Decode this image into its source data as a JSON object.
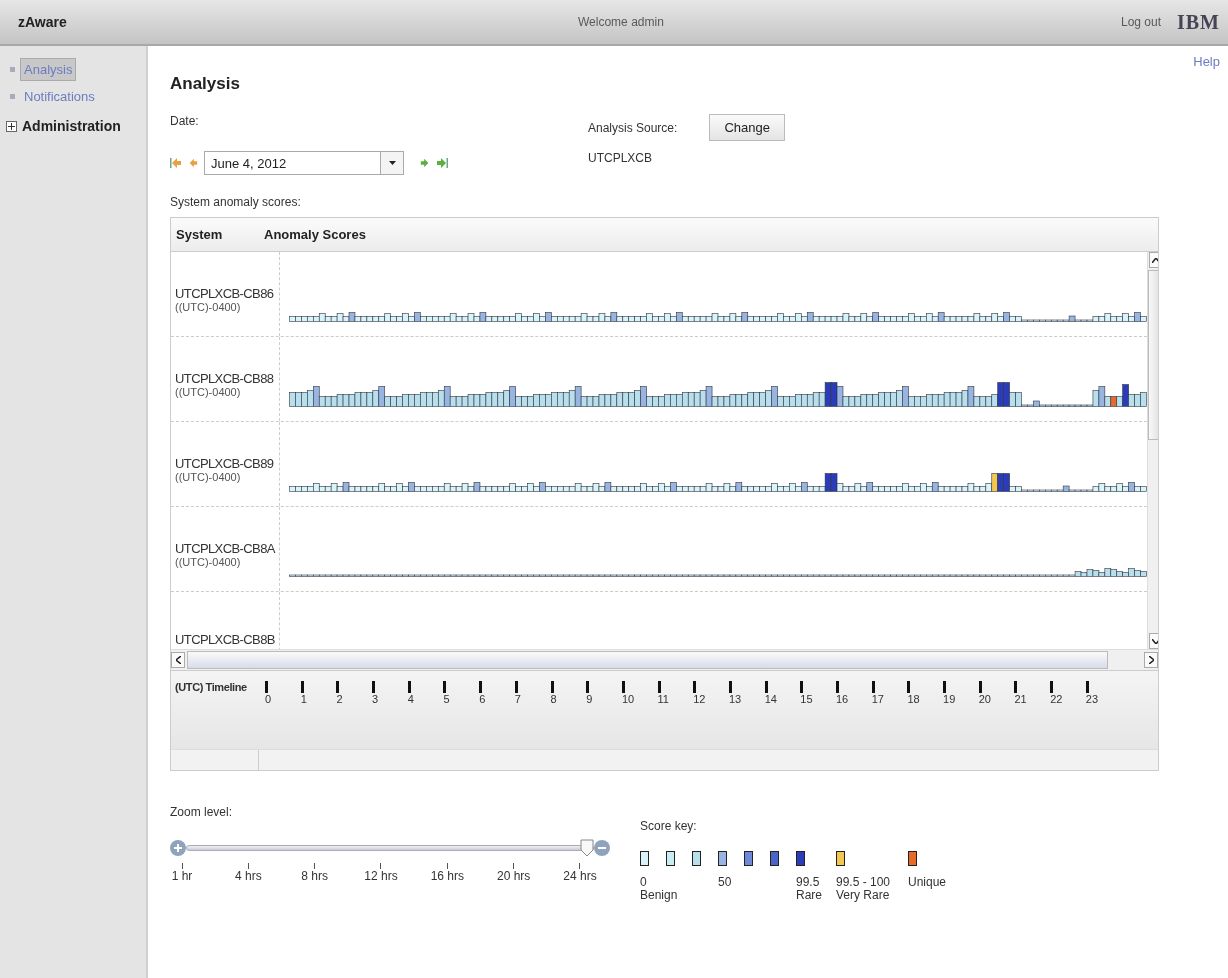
{
  "header": {
    "app_name": "zAware",
    "welcome": "Welcome admin",
    "logout": "Log out",
    "logo": "IBM"
  },
  "sidebar": {
    "items": [
      {
        "kind": "link",
        "label": "Analysis",
        "selected": true
      },
      {
        "kind": "link",
        "label": "Notifications",
        "selected": false
      },
      {
        "kind": "group",
        "label": "Administration",
        "selected": false,
        "expanded": false
      }
    ]
  },
  "help": "Help",
  "page_title": "Analysis",
  "date": {
    "label": "Date:",
    "value": "June 4, 2012"
  },
  "source": {
    "label": "Analysis Source:",
    "button": "Change",
    "value": "UTCPLXCB"
  },
  "table": {
    "caption": "System anomaly scores:",
    "columns": [
      "System",
      "Anomaly Scores"
    ],
    "rows": [
      {
        "system": "UTCPLXCB-CB86",
        "timezone": "((UTC)-0400)"
      },
      {
        "system": "UTCPLXCB-CB88",
        "timezone": "((UTC)-0400)"
      },
      {
        "system": "UTCPLXCB-CB89",
        "timezone": "((UTC)-0400)"
      },
      {
        "system": "UTCPLXCB-CB8A",
        "timezone": "((UTC)-0400)"
      },
      {
        "system": "UTCPLXCB-CB8B"
      }
    ],
    "timeline_label": "(UTC) Timeline",
    "timeline_ticks": [
      "0",
      "1",
      "2",
      "3",
      "4",
      "5",
      "6",
      "7",
      "8",
      "9",
      "10",
      "11",
      "12",
      "13",
      "14",
      "15",
      "16",
      "17",
      "18",
      "19",
      "20",
      "21",
      "22",
      "23"
    ]
  },
  "zoom": {
    "label": "Zoom level:",
    "level": 1,
    "ticks": [
      "1 hr",
      "4 hrs",
      "8 hrs",
      "12 hrs",
      "16 hrs",
      "20 hrs",
      "24 hrs"
    ]
  },
  "score_key": {
    "label": "Score key:",
    "items": [
      {
        "color": "#d8f4f8",
        "lines": [
          "0",
          "Benign"
        ]
      },
      {
        "color": "#c8eef4"
      },
      {
        "color": "#b8e0ec"
      },
      {
        "color": "#98b4e0",
        "lines": [
          "50"
        ]
      },
      {
        "color": "#7088d8"
      },
      {
        "color": "#4a64c8"
      },
      {
        "color": "#2a3cb8",
        "lines": [
          "99.5",
          "Rare"
        ]
      },
      {
        "color": "#f4c850",
        "lines": [
          "99.5 - 100",
          "Very Rare"
        ]
      },
      {
        "color": "#e86a28",
        "lines": [
          "Unique"
        ]
      }
    ]
  }
}
